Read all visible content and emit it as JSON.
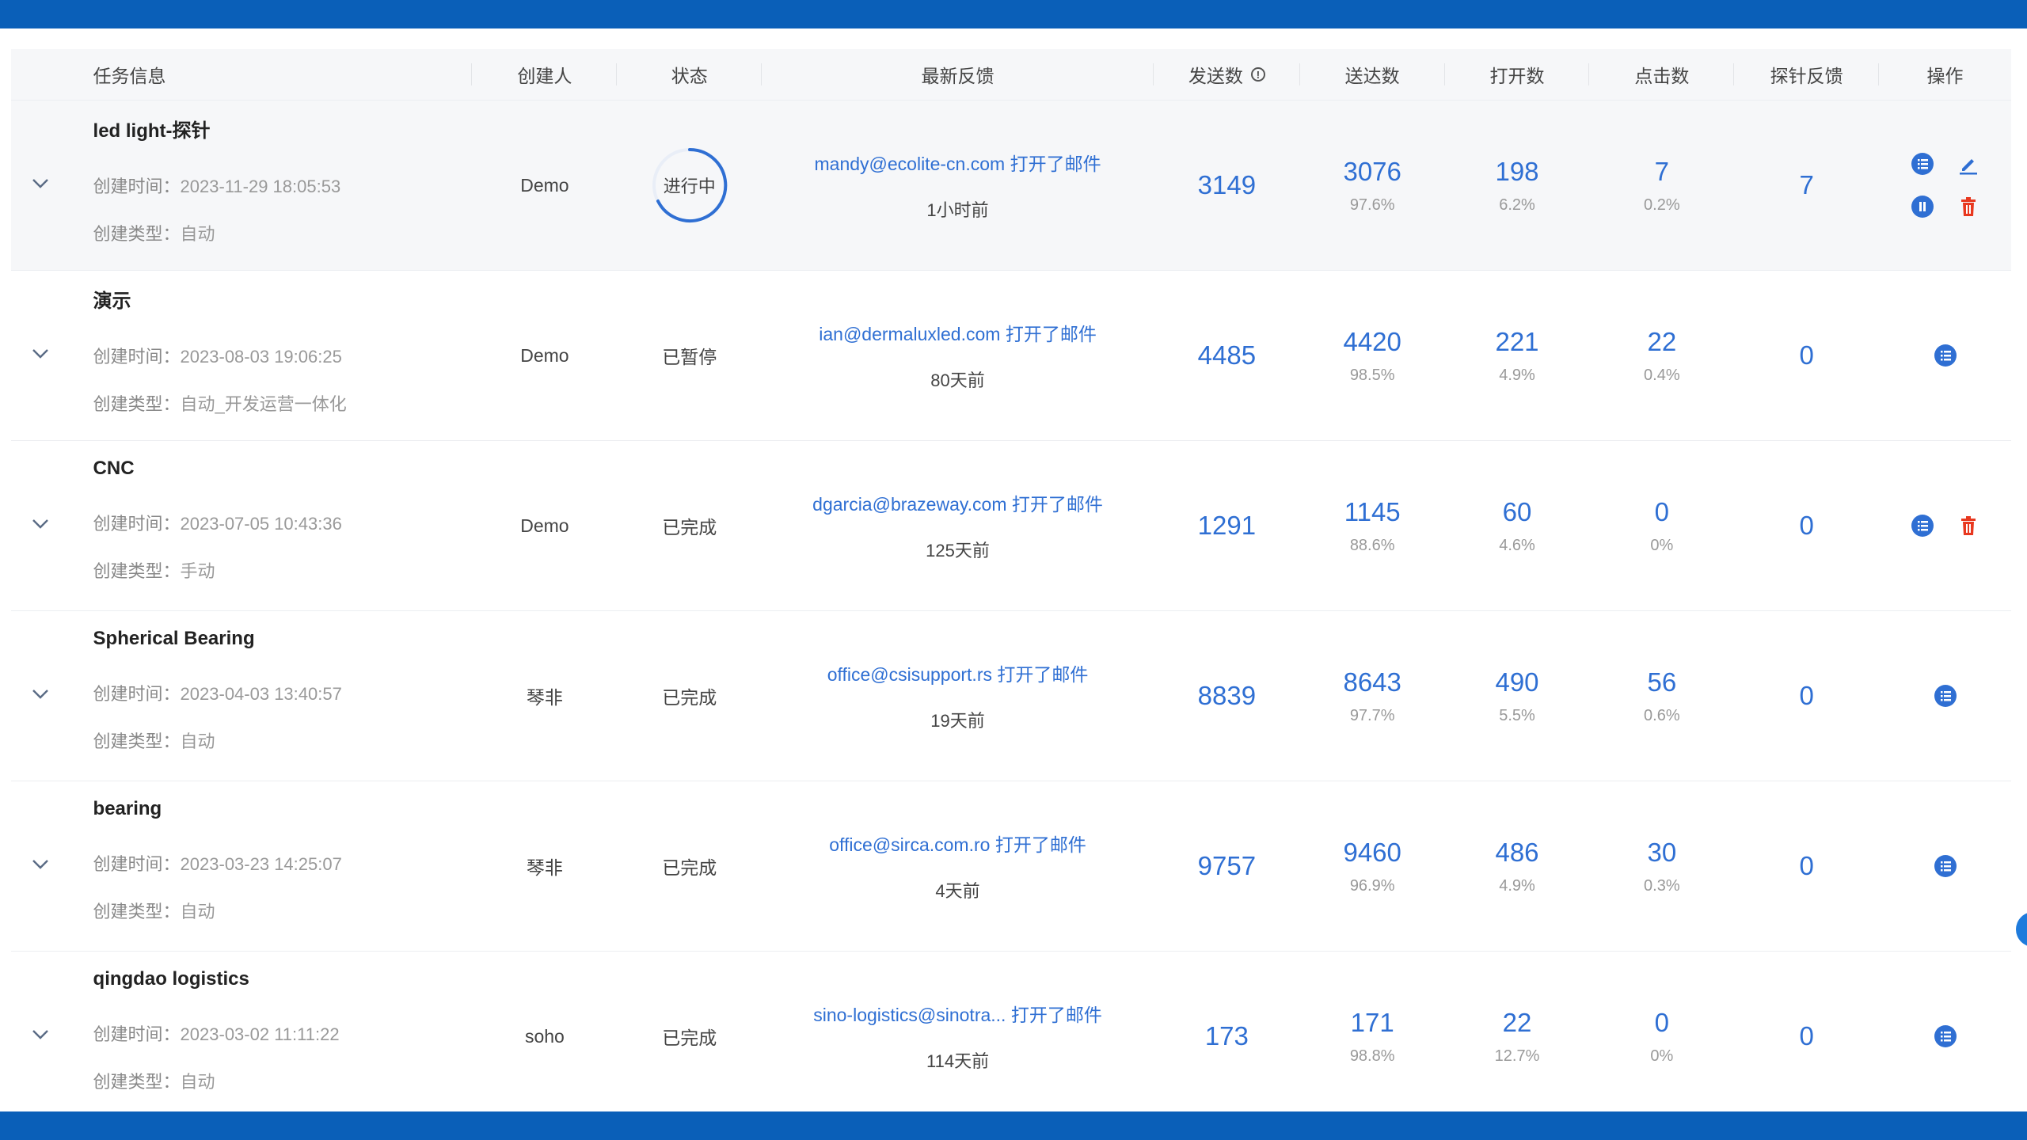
{
  "headers": {
    "task_info": "任务信息",
    "creator": "创建人",
    "status": "状态",
    "latest_feedback": "最新反馈",
    "sent": "发送数",
    "sent_info_icon": "info-circle-icon",
    "delivered": "送达数",
    "opened": "打开数",
    "clicked": "点击数",
    "probe_feedback": "探针反馈",
    "operations": "操作"
  },
  "labels": {
    "created_time": "创建时间：",
    "created_type": "创建类型：",
    "opened_email": "打开了邮件"
  },
  "colors": {
    "brand": "#0a5fb8",
    "link": "#2f6fd3",
    "danger": "#e8381f"
  },
  "rows": [
    {
      "name": "led light-探针",
      "time": "2023-11-29 18:05:53",
      "type": "自动",
      "creator": "Demo",
      "status": "进行中",
      "email": "mandy@ecolite-cn.com",
      "ago": "1小时前",
      "sent": "3149",
      "delivered": "3076",
      "delivered_pct": "97.6%",
      "opened": "198",
      "opened_pct": "6.2%",
      "clicked": "7",
      "clicked_pct": "0.2%",
      "probe": "7",
      "ops": [
        "list-icon",
        "edit-icon",
        "pause-icon",
        "delete-icon"
      ]
    },
    {
      "name": "演示",
      "time": "2023-08-03 19:06:25",
      "type": "自动_开发运营一体化",
      "creator": "Demo",
      "status": "已暂停",
      "email": "ian@dermaluxled.com",
      "ago": "80天前",
      "sent": "4485",
      "delivered": "4420",
      "delivered_pct": "98.5%",
      "opened": "221",
      "opened_pct": "4.9%",
      "clicked": "22",
      "clicked_pct": "0.4%",
      "probe": "0",
      "ops": [
        "list-icon"
      ]
    },
    {
      "name": "CNC",
      "time": "2023-07-05 10:43:36",
      "type": "手动",
      "creator": "Demo",
      "status": "已完成",
      "email": "dgarcia@brazeway.com",
      "ago": "125天前",
      "sent": "1291",
      "delivered": "1145",
      "delivered_pct": "88.6%",
      "opened": "60",
      "opened_pct": "4.6%",
      "clicked": "0",
      "clicked_pct": "0%",
      "probe": "0",
      "ops": [
        "list-icon",
        "delete-icon"
      ]
    },
    {
      "name": "Spherical Bearing",
      "time": "2023-04-03 13:40:57",
      "type": "自动",
      "creator": "琴非",
      "status": "已完成",
      "email": "office@csisupport.rs",
      "ago": "19天前",
      "sent": "8839",
      "delivered": "8643",
      "delivered_pct": "97.7%",
      "opened": "490",
      "opened_pct": "5.5%",
      "clicked": "56",
      "clicked_pct": "0.6%",
      "probe": "0",
      "ops": [
        "list-icon"
      ]
    },
    {
      "name": "bearing",
      "time": "2023-03-23 14:25:07",
      "type": "自动",
      "creator": "琴非",
      "status": "已完成",
      "email": "office@sirca.com.ro",
      "ago": "4天前",
      "sent": "9757",
      "delivered": "9460",
      "delivered_pct": "96.9%",
      "opened": "486",
      "opened_pct": "4.9%",
      "clicked": "30",
      "clicked_pct": "0.3%",
      "probe": "0",
      "ops": [
        "list-icon"
      ]
    },
    {
      "name": "qingdao logistics",
      "time": "2023-03-02 11:11:22",
      "type": "自动",
      "creator": "soho",
      "status": "已完成",
      "email": "sino-logistics@sinotra...",
      "ago": "114天前",
      "sent": "173",
      "delivered": "171",
      "delivered_pct": "98.8%",
      "opened": "22",
      "opened_pct": "12.7%",
      "clicked": "0",
      "clicked_pct": "0%",
      "probe": "0",
      "ops": [
        "list-icon"
      ]
    }
  ]
}
